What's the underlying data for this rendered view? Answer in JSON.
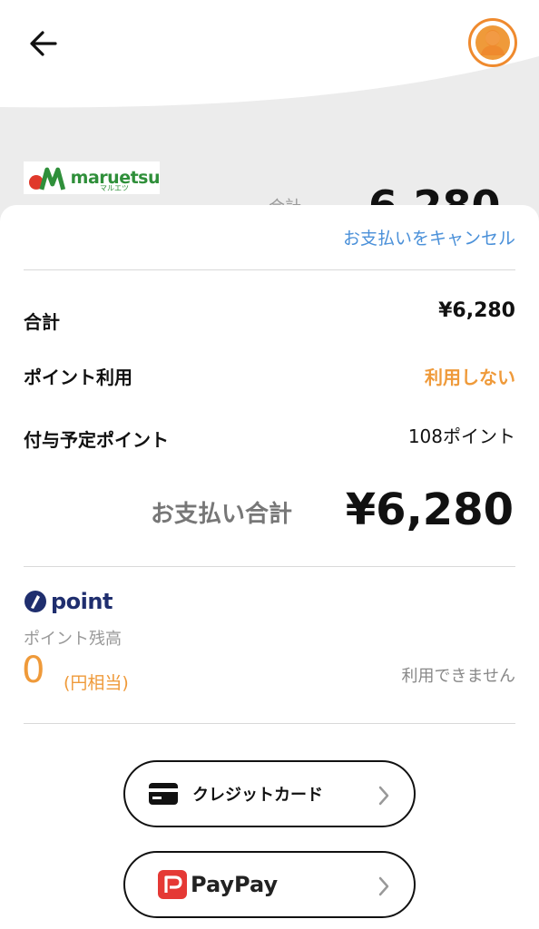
{
  "header": {
    "back_icon": "arrow-left-icon",
    "avatar_icon": "user-icon",
    "accent_color": "#ef8a2e"
  },
  "store": {
    "brand": "maruetsu",
    "brand_sub": "マルエツ"
  },
  "peek": {
    "label": "合計",
    "amount": "6,280"
  },
  "sheet": {
    "cancel_label": "お支払いをキャンセル",
    "total_label": "合計",
    "total_value": "¥6,280",
    "point_use_label": "ポイント利用",
    "point_use_value": "利用しない",
    "earn_label": "付与予定ポイント",
    "earn_value": "108ポイント",
    "pay_total_label": "お支払い合計",
    "pay_total_amount": "¥6,280"
  },
  "point_section": {
    "logo_text": "point",
    "balance_label": "ポイント残高",
    "balance_value": "0",
    "balance_unit": "(円相当)",
    "status": "利用できません"
  },
  "payment_methods": [
    {
      "label": "クレジットカード",
      "icon": "credit-card-icon"
    },
    {
      "label": "PayPay",
      "icon": "paypay-logo-icon"
    }
  ],
  "colors": {
    "link": "#4a90d9",
    "orange": "#ef9a3a",
    "brand_green": "#2f8f3a",
    "point_navy": "#1f2e6e",
    "paypay_red": "#e53935"
  }
}
